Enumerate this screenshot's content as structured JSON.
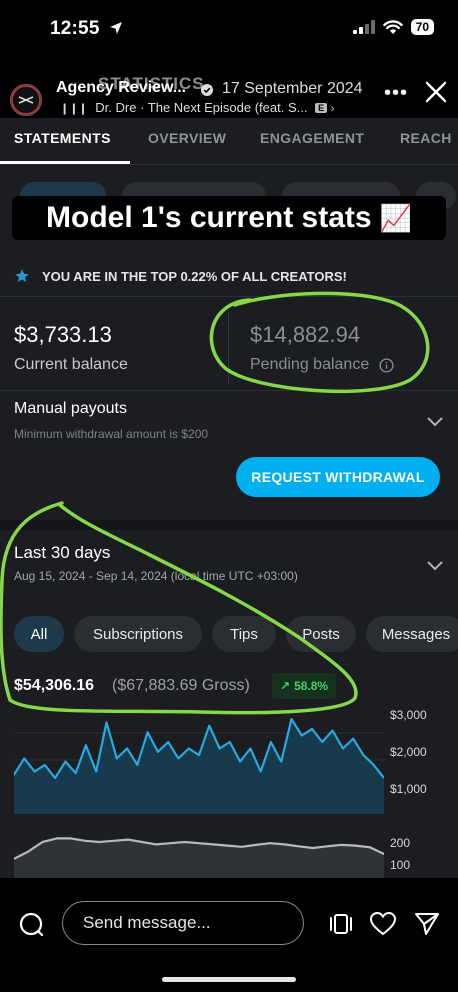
{
  "status_bar": {
    "time": "12:55",
    "battery": "70"
  },
  "story": {
    "username": "Agency Review...",
    "date": "17 September 2024",
    "music": "Dr. Dre · The Next Episode (feat. S...",
    "music_badge": "E",
    "ghost_title": "STATISTICS"
  },
  "tabs": [
    "STATEMENTS",
    "OVERVIEW",
    "ENGAGEMENT",
    "REACH"
  ],
  "overlay": {
    "text": "Model 1's current stats",
    "emoji": "📈"
  },
  "top_creators": "YOU ARE IN THE TOP 0.22% OF ALL CREATORS!",
  "current_balance": {
    "amount": "$3,733.13",
    "label": "Current balance"
  },
  "pending_balance": {
    "amount": "$14,882.94",
    "label": "Pending balance"
  },
  "manual_payouts": {
    "title": "Manual payouts",
    "subtitle": "Minimum withdrawal amount is $200"
  },
  "withdraw_button": "REQUEST WITHDRAWAL",
  "period": {
    "title": "Last 30 days",
    "range": "Aug 15, 2024 - Sep 14, 2024 (local time UTC +03:00)"
  },
  "filter_chips": [
    "All",
    "Subscriptions",
    "Tips",
    "Posts",
    "Messages"
  ],
  "earnings": {
    "net": "$54,306.16",
    "gross": "($67,883.69 Gross)",
    "change": "58.8%"
  },
  "chart_data": [
    {
      "type": "area",
      "y_ticks": [
        "$3,000",
        "$2,000",
        "$1,000"
      ],
      "ylim": [
        0,
        3300
      ],
      "values": [
        1200,
        1700,
        1300,
        1500,
        1100,
        1600,
        1250,
        2100,
        1300,
        2800,
        1700,
        2000,
        1500,
        2500,
        1900,
        2200,
        1700,
        2000,
        1800,
        2700,
        2000,
        2200,
        1600,
        2000,
        1300,
        2200,
        1600,
        2900,
        2400,
        2600,
        2200,
        2550,
        2000,
        2300,
        1800,
        1500,
        1100
      ],
      "color": "#29a9e0",
      "fill": "#173a4d"
    },
    {
      "type": "area",
      "y_ticks": [
        "200",
        "100"
      ],
      "ylim": [
        40,
        240
      ],
      "values": [
        120,
        150,
        190,
        205,
        205,
        195,
        190,
        195,
        200,
        190,
        180,
        185,
        190,
        185,
        180,
        175,
        170,
        178,
        185,
        180,
        172,
        165,
        172,
        178,
        175,
        168,
        140
      ],
      "color": "#b7babd",
      "fill": "#2f3236"
    }
  ],
  "bottom_bar": {
    "message_placeholder": "Send message..."
  },
  "colors": {
    "accent": "#00aff0",
    "ink": "#86d84a",
    "growth": "#40d36a"
  }
}
